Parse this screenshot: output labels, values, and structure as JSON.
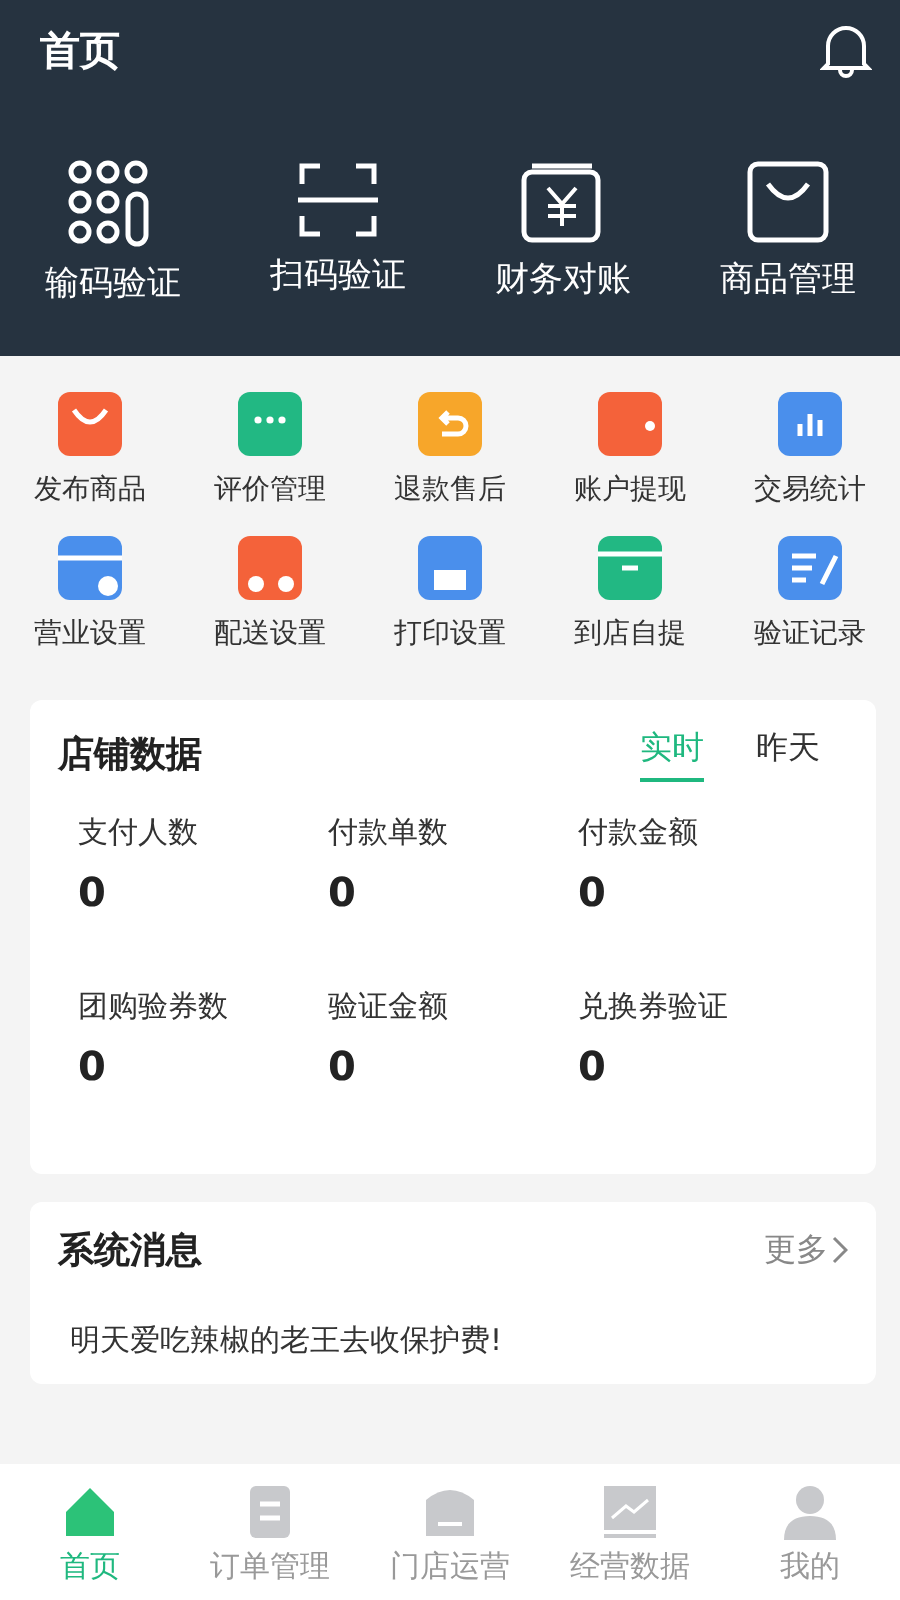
{
  "header": {
    "title": "首页"
  },
  "quick_actions": [
    {
      "label": "输码验证"
    },
    {
      "label": "扫码验证"
    },
    {
      "label": "财务对账"
    },
    {
      "label": "商品管理"
    }
  ],
  "shortcuts": [
    {
      "label": "发布商品"
    },
    {
      "label": "评价管理"
    },
    {
      "label": "退款售后"
    },
    {
      "label": "账户提现"
    },
    {
      "label": "交易统计"
    },
    {
      "label": "营业设置"
    },
    {
      "label": "配送设置"
    },
    {
      "label": "打印设置"
    },
    {
      "label": "到店自提"
    },
    {
      "label": "验证记录"
    }
  ],
  "store_data": {
    "title": "店铺数据",
    "tabs": [
      {
        "label": "实时",
        "selected": true
      },
      {
        "label": "昨天",
        "selected": false
      }
    ],
    "stats": [
      {
        "label": "支付人数",
        "value": "0"
      },
      {
        "label": "付款单数",
        "value": "0"
      },
      {
        "label": "付款金额",
        "value": "0"
      },
      {
        "label": "团购验券数",
        "value": "0"
      },
      {
        "label": "验证金额",
        "value": "0"
      },
      {
        "label": "兑换券验证",
        "value": "0"
      }
    ]
  },
  "messages": {
    "title": "系统消息",
    "more": "更多",
    "items": [
      "明天爱吃辣椒的老王去收保护费!"
    ]
  },
  "tab_bar": [
    {
      "label": "首页",
      "selected": true
    },
    {
      "label": "订单管理",
      "selected": false
    },
    {
      "label": "门店运营",
      "selected": false
    },
    {
      "label": "经营数据",
      "selected": false
    },
    {
      "label": "我的",
      "selected": false
    }
  ]
}
